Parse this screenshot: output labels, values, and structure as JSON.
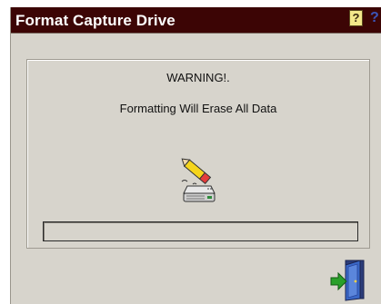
{
  "window": {
    "title": "Format Capture Drive",
    "help_label": "?",
    "help_label_2": "?"
  },
  "panel": {
    "warning": "WARNING!.",
    "message": "Formatting Will Erase All Data",
    "progress": 0
  },
  "icons": {
    "drive": "eraser-drive-icon",
    "exit": "exit-door-icon",
    "help": "help-icon"
  },
  "colors": {
    "titlebar": "#3c0505",
    "background": "#d7d4cc",
    "help_button": "#f3e88a",
    "exit_arrow": "#2aa02a",
    "door": "#3a68c8"
  }
}
